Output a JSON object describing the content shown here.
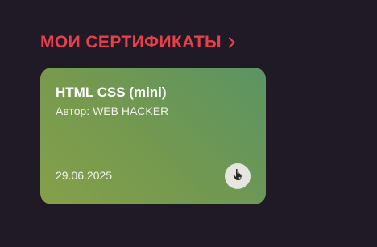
{
  "section": {
    "title": "МОИ СЕРТИФИКАТЫ",
    "chevron_icon": "chevron-right-icon",
    "accent_color": "#e8404a"
  },
  "certificates": [
    {
      "title": "HTML CSS (mini)",
      "author": "Автор: WEB HACKER",
      "date": "29.06.2025",
      "action_icon": "pointer-hand-icon",
      "gradient_colors": [
        "#86a04a",
        "#5b9463"
      ]
    }
  ]
}
